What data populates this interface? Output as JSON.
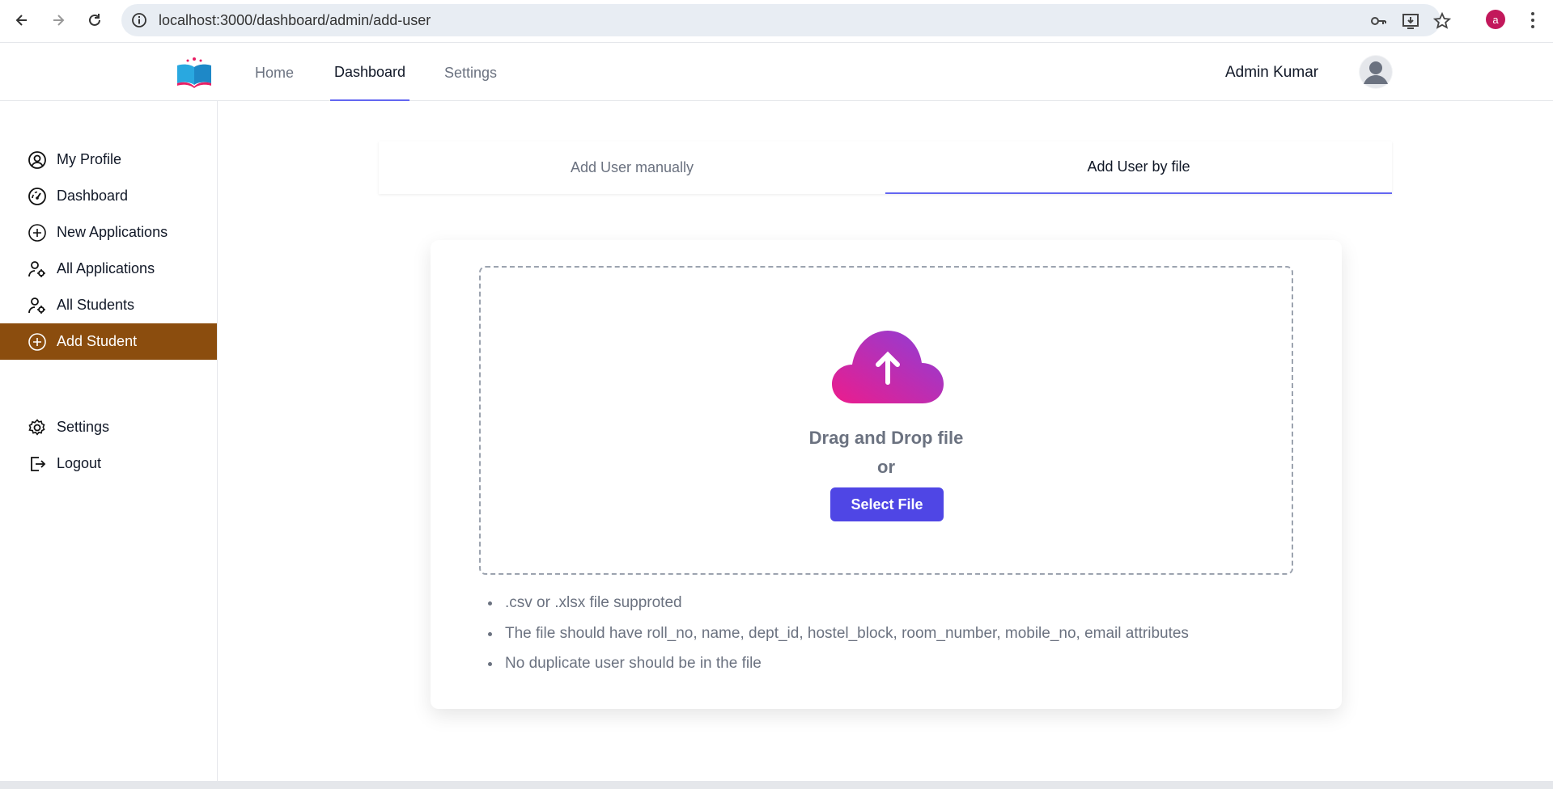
{
  "browser": {
    "url": "localhost:3000/dashboard/admin/add-user",
    "profile_initial": "a",
    "icons": [
      "back-arrow-icon",
      "forward-arrow-icon",
      "reload-icon",
      "site-info-icon",
      "password-key-icon",
      "install-app-icon",
      "bookmark-star-icon",
      "more-menu-icon"
    ]
  },
  "header": {
    "nav": [
      {
        "label": "Home"
      },
      {
        "label": "Dashboard"
      },
      {
        "label": "Settings"
      }
    ],
    "active_nav": "Dashboard",
    "user_name": "Admin Kumar"
  },
  "sidebar": {
    "items": [
      {
        "label": "My Profile",
        "icon": "user-circle-icon"
      },
      {
        "label": "Dashboard",
        "icon": "gauge-icon"
      },
      {
        "label": "New Applications",
        "icon": "plus-circle-icon"
      },
      {
        "label": "All Applications",
        "icon": "user-gear-icon"
      },
      {
        "label": "All Students",
        "icon": "user-gear-icon"
      },
      {
        "label": "Add Student",
        "icon": "plus-circle-icon"
      }
    ],
    "active_item": "Add Student",
    "bottom_items": [
      {
        "label": "Settings",
        "icon": "gear-icon"
      },
      {
        "label": "Logout",
        "icon": "logout-icon"
      }
    ],
    "active_color": "#8b4d0e"
  },
  "tabs": [
    {
      "label": "Add User manually"
    },
    {
      "label": "Add User by file"
    }
  ],
  "active_tab": "Add User by file",
  "upload": {
    "title": "Drag and Drop file",
    "or": "or",
    "button_label": "Select File",
    "button_color": "#4f46e5"
  },
  "notes": [
    ".csv or .xlsx file supproted",
    "The file should have roll_no, name, dept_id, hostel_block, room_number, mobile_no, email attributes",
    "No duplicate user should be in the file"
  ],
  "accent_color": "#6366f1"
}
